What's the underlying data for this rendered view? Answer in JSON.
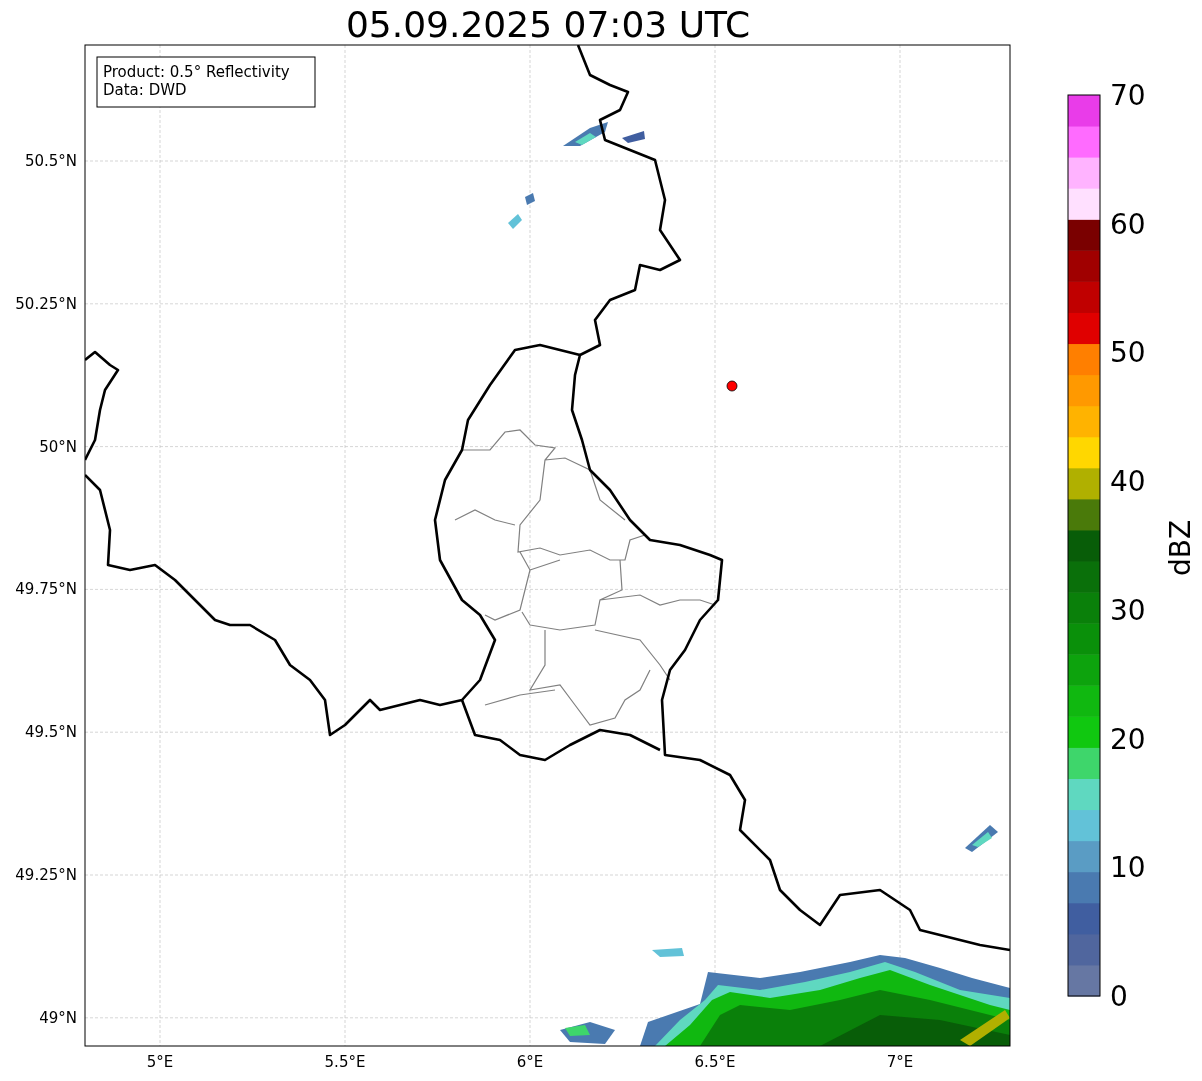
{
  "title": "05.09.2025 07:03 UTC",
  "info_box": {
    "lines": [
      "Product: 0.5° Reflectivity",
      "Data: DWD"
    ]
  },
  "x_ticks": [
    "5°E",
    "5.5°E",
    "6°E",
    "6.5°E",
    "7°E"
  ],
  "y_ticks": [
    "50.5°N",
    "50.25°N",
    "50°N",
    "49.75°N",
    "49.5°N",
    "49.25°N",
    "49°N"
  ],
  "colorbar": {
    "label": "dBZ",
    "ticks": [
      "70",
      "60",
      "50",
      "40",
      "30",
      "20",
      "10",
      "0"
    ],
    "segments": [
      {
        "color": "#6677a3"
      },
      {
        "color": "#50669e"
      },
      {
        "color": "#405ea0"
      },
      {
        "color": "#4a7ab0"
      },
      {
        "color": "#5a9cc4"
      },
      {
        "color": "#62c2d8"
      },
      {
        "color": "#5fd8c0"
      },
      {
        "color": "#3ed66b"
      },
      {
        "color": "#10c810"
      },
      {
        "color": "#10b810"
      },
      {
        "color": "#0da30d"
      },
      {
        "color": "#0a900a"
      },
      {
        "color": "#0a800a"
      },
      {
        "color": "#0a700a"
      },
      {
        "color": "#085d08"
      },
      {
        "color": "#4a7a0a"
      },
      {
        "color": "#b0b000"
      },
      {
        "color": "#ffd700"
      },
      {
        "color": "#ffb300"
      },
      {
        "color": "#ff9900"
      },
      {
        "color": "#ff7f00"
      },
      {
        "color": "#e00000"
      },
      {
        "color": "#c00000"
      },
      {
        "color": "#a00000"
      },
      {
        "color": "#7a0000"
      },
      {
        "color": "#ffe0ff"
      },
      {
        "color": "#ffb3ff"
      },
      {
        "color": "#ff6bff"
      },
      {
        "color": "#e93ce9"
      }
    ]
  }
}
